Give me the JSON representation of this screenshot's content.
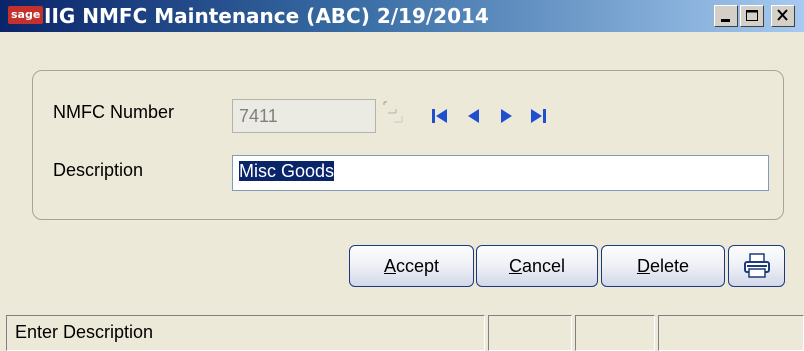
{
  "window": {
    "logo_text": "sage",
    "title": "IIG NMFC Maintenance (ABC) 2/19/2014",
    "controls": [
      "minimize-icon",
      "maximize-icon",
      "close-icon"
    ]
  },
  "form": {
    "nmfc_label": "NMFC Number",
    "nmfc_value": "7411",
    "description_label": "Description",
    "description_value": "Misc Goods"
  },
  "navigation": [
    "first-record-icon",
    "previous-record-icon",
    "next-record-icon",
    "last-record-icon"
  ],
  "buttons": {
    "accept_mnemonic": "A",
    "accept_rest": "ccept",
    "cancel_mnemonic": "C",
    "cancel_rest": "ancel",
    "delete_mnemonic": "D",
    "delete_rest": "elete",
    "print_icon": "printer-icon"
  },
  "statusbar": {
    "message": "Enter Description",
    "pane2": "",
    "pane3": "",
    "pane4": ""
  },
  "colors": {
    "titlebar_start": "#0a246a",
    "titlebar_end": "#a6caf0",
    "selection": "#0a246a",
    "nav_arrows": "#1f4fd1",
    "button_border": "#1c3a7d",
    "face": "#ece9d8"
  }
}
